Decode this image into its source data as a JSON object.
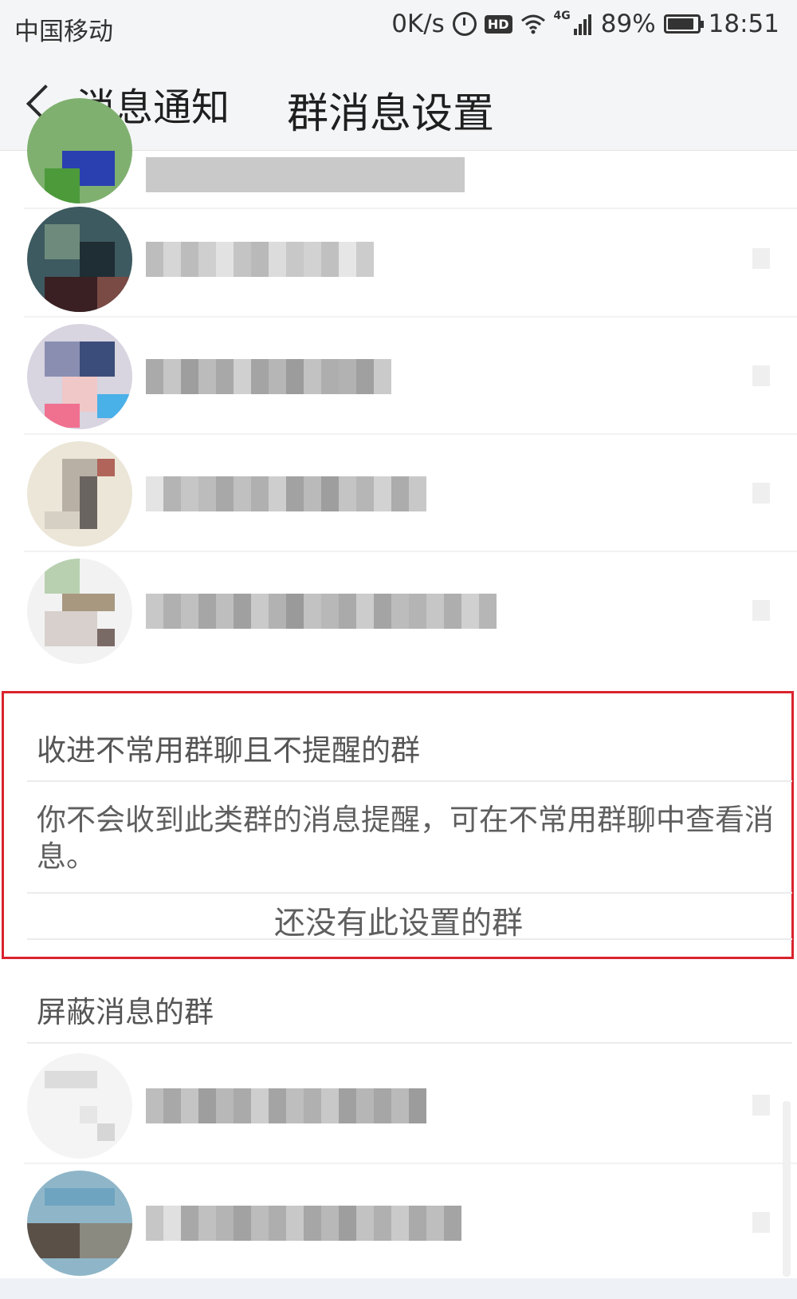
{
  "status_bar": {
    "carrier": "中国移动",
    "speed": "0K/s",
    "network": "4G",
    "battery": "89%",
    "battery_level": 0.89,
    "time": "18:51"
  },
  "title_bar": {
    "back_label": "消息通知",
    "title": "群消息设置"
  },
  "sections": {
    "unused_groups": {
      "header": "收进不常用群聊且不提醒的群",
      "description": "你不会收到此类群的消息提醒，可在不常用群聊中查看消息。",
      "empty_note": "还没有此设置的群"
    },
    "muted_groups": {
      "header": "屏蔽消息的群"
    }
  },
  "colors": {
    "highlight_border": "#d9232d",
    "status_bg": "#f4f5f7",
    "text_primary": "#1f1f1f",
    "text_secondary": "#5f5f5f"
  }
}
